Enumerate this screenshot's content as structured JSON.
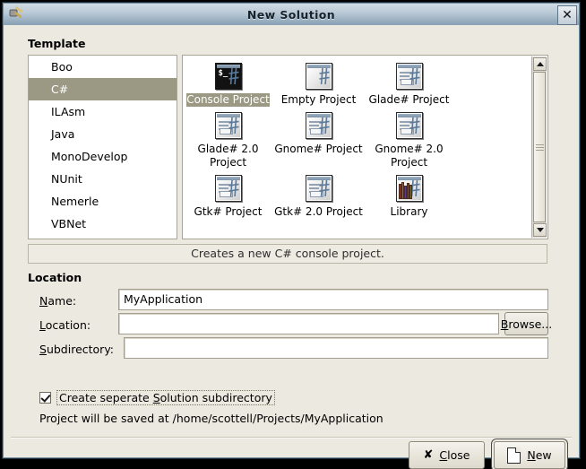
{
  "window": {
    "title": "New Solution",
    "title_icon": "hammer-icon",
    "close_icon": "✕"
  },
  "template_section": {
    "heading": "Template",
    "languages": [
      {
        "label": "Boo",
        "selected": false
      },
      {
        "label": "C#",
        "selected": true
      },
      {
        "label": "ILAsm",
        "selected": false
      },
      {
        "label": "Java",
        "selected": false
      },
      {
        "label": "MonoDevelop",
        "selected": false
      },
      {
        "label": "NUnit",
        "selected": false
      },
      {
        "label": "Nemerle",
        "selected": false
      },
      {
        "label": "VBNet",
        "selected": false
      }
    ],
    "projects": [
      {
        "label": "Console Project",
        "icon": "console-terminal-icon",
        "selected": true
      },
      {
        "label": "Empty Project",
        "icon": "empty-window-icon",
        "selected": false
      },
      {
        "label": "Glade# Project",
        "icon": "glade-window-icon",
        "selected": false
      },
      {
        "label": "Glade# 2.0 Project",
        "icon": "glade-window-icon",
        "selected": false
      },
      {
        "label": "Gnome# Project",
        "icon": "gnome-window-icon",
        "selected": false
      },
      {
        "label": "Gnome# 2.0 Project",
        "icon": "gnome-window-icon",
        "selected": false
      },
      {
        "label": "Gtk# Project",
        "icon": "gtk-window-icon",
        "selected": false
      },
      {
        "label": "Gtk# 2.0 Project",
        "icon": "gtk-window-icon",
        "selected": false
      },
      {
        "label": "Library",
        "icon": "library-books-icon",
        "selected": false
      }
    ],
    "description": "Creates a new C# console project."
  },
  "location_section": {
    "heading": "Location",
    "name_label_mnemonic": "N",
    "name_label_rest": "ame:",
    "name_value": "MyApplication",
    "location_label_mnemonic": "L",
    "location_label_rest": "ocation:",
    "location_value": "",
    "subdirectory_label_mnemonic": "S",
    "subdirectory_label_rest": "ubdirectory:",
    "subdirectory_value": "",
    "browse_mnemonic": "B",
    "browse_rest": "rowse...",
    "checkbox_pre": "Create seperate ",
    "checkbox_mnemonic": "S",
    "checkbox_post": "olution subdirectory",
    "checkbox_checked": true,
    "saved_path_text": "Project will be saved at /home/scottell/Projects/MyApplication"
  },
  "footer": {
    "close_mnemonic": "C",
    "close_rest": "lose",
    "close_icon": "✘",
    "new_mnemonic": "N",
    "new_rest": "ew",
    "new_icon": "document-icon"
  },
  "colors": {
    "window_bg": "#ece9e1",
    "selection": "#9b9884",
    "titlebar_top": "#cfdae4",
    "titlebar_bottom": "#88a0b4"
  }
}
